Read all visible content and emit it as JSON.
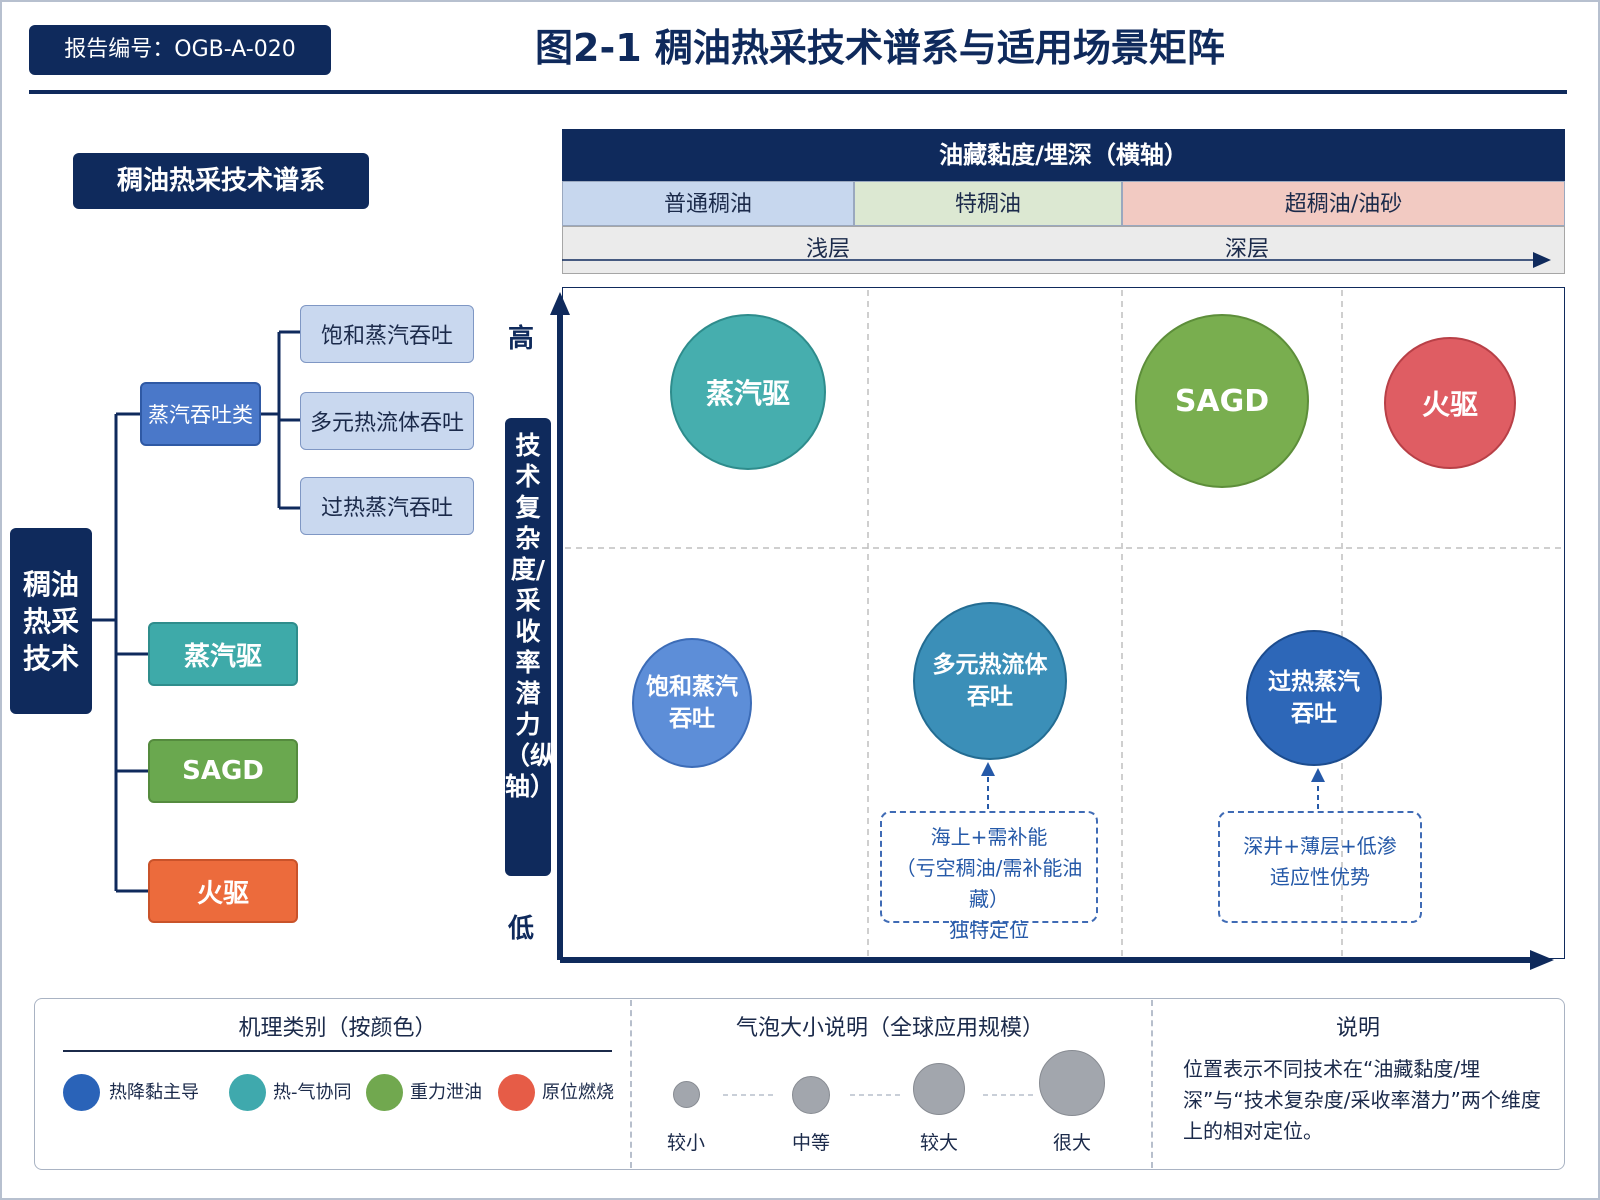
{
  "report_id": "报告编号：OGB-A-020",
  "title": "图2-1 稠油热采技术谱系与适用场景矩阵",
  "tree": {
    "header": "稠油热采技术谱系",
    "root": "稠油热采技术",
    "category": "蒸汽吞吐类",
    "leaves": [
      "饱和蒸汽吞吐",
      "多元热流体吞吐",
      "过热蒸汽吞吐"
    ],
    "branches": [
      "蒸汽驱",
      "SAGD",
      "火驱"
    ]
  },
  "x_axis": {
    "title": "油藏黏度/埋深（横轴）",
    "bands": [
      "普通稠油",
      "特稠油",
      "超稠油/油砂"
    ],
    "depth": [
      "浅层",
      "深层"
    ]
  },
  "y_axis": {
    "title": "技术复杂度/采收率潜力（纵轴）",
    "high": "高",
    "low": "低"
  },
  "bubbles": {
    "steam_drive": "蒸汽驱",
    "sagd": "SAGD",
    "fire_flood": "火驱",
    "cyclic_l1": "饱和蒸汽",
    "cyclic_l2": "吞吐",
    "multi_l1": "多元热流体",
    "multi_l2": "吞吐",
    "super_l1": "过热蒸汽",
    "super_l2": "吞吐"
  },
  "callouts": {
    "multi": [
      "海上+需补能",
      "（亏空稠油/需补能油藏）",
      "独特定位"
    ],
    "super": [
      "深井+薄层+低渗",
      "适应性优势"
    ]
  },
  "legend": {
    "mechanism_title": "机理类别（按颜色）",
    "mechanisms": [
      {
        "label": "热降黏主导",
        "color": "#2a63b8"
      },
      {
        "label": "热-气协同",
        "color": "#3fa9ad"
      },
      {
        "label": "重力泄油",
        "color": "#71a84f"
      },
      {
        "label": "原位燃烧",
        "color": "#e65c47"
      }
    ],
    "size_title": "气泡大小说明（全球应用规模）",
    "sizes": [
      "较小",
      "中等",
      "较大",
      "很大"
    ],
    "note_title": "说明",
    "note_text": "位置表示不同技术在“油藏黏度/埋深”与“技术复杂度/采收率潜力”两个维度上的相对定位。"
  },
  "colors": {
    "navy": "#0f2a5c",
    "steam": "#46aeae",
    "sagd": "#79ae4f",
    "fire": "#df5d63"
  }
}
